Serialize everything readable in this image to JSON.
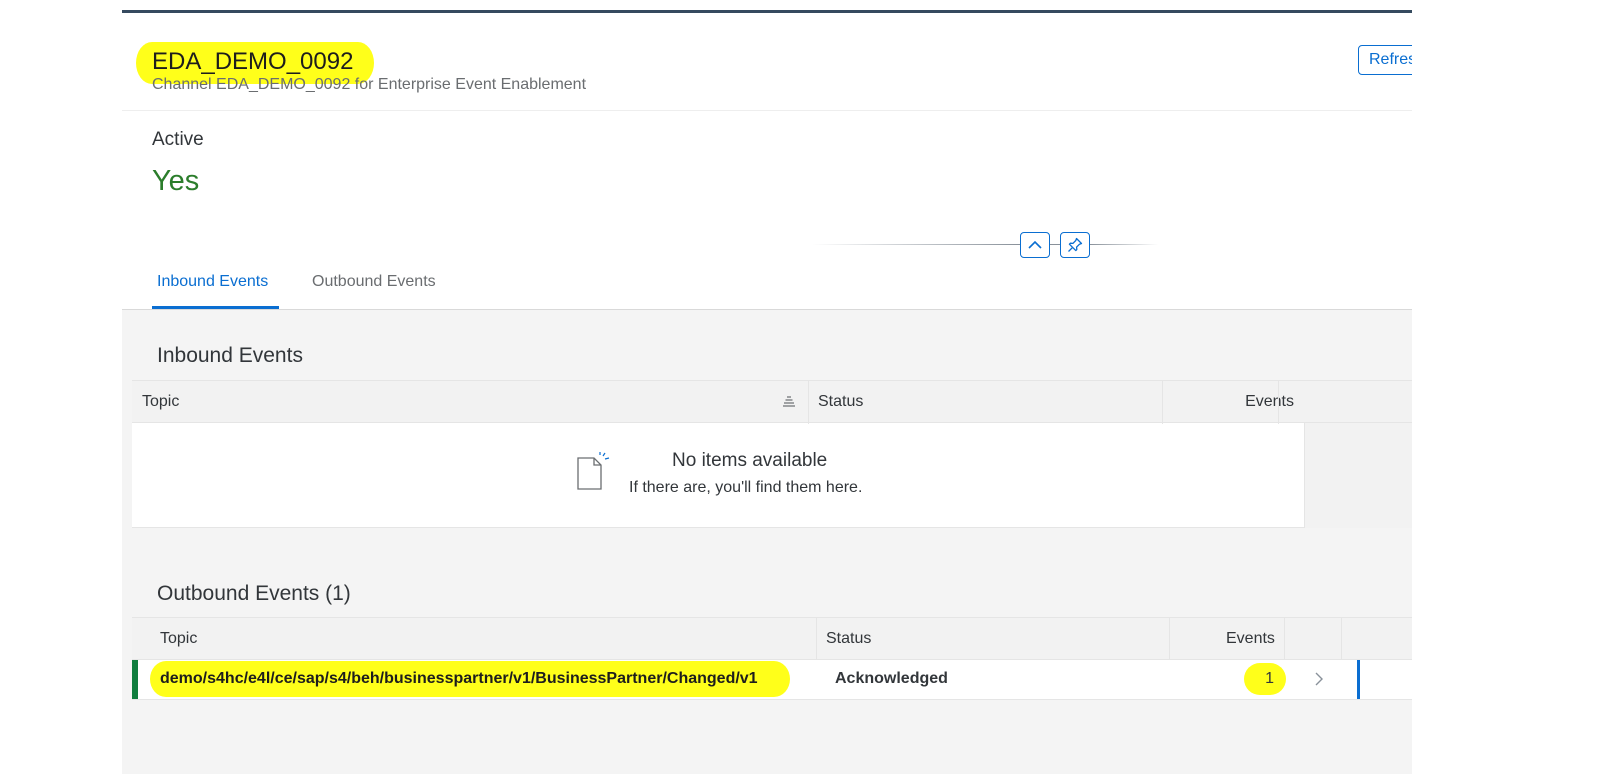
{
  "header": {
    "title": "EDA_DEMO_0092",
    "subtitle": "Channel EDA_DEMO_0092 for Enterprise Event Enablement",
    "refresh_label": "Refres"
  },
  "attributes": {
    "active_label": "Active",
    "active_value": "Yes"
  },
  "tabs": [
    {
      "label": "Inbound Events",
      "selected": true
    },
    {
      "label": "Outbound Events",
      "selected": false
    }
  ],
  "inbound": {
    "title": "Inbound Events",
    "columns": [
      "Topic",
      "Status",
      "Events"
    ],
    "no_data_title": "No items available",
    "no_data_text": "If there are, you'll find them here."
  },
  "outbound": {
    "title": "Outbound Events (1)",
    "columns": [
      "Topic",
      "Status",
      "Events"
    ],
    "rows": [
      {
        "topic": "demo/s4hc/e4l/ce/sap/s4/beh/businesspartner/v1/BusinessPartner/Changed/v1",
        "status": "Acknowledged",
        "events": "1"
      }
    ]
  },
  "icons": {
    "sort": "sort-icon",
    "collapse": "chevron-up-icon",
    "pin": "pin-icon",
    "no_data": "document-icon",
    "navigation": "chevron-right-icon"
  },
  "colors": {
    "accent": "#0a6ed1",
    "success": "#2b7d2b",
    "highlight": "#ffff1a",
    "shell_bar": "#354a5f"
  }
}
